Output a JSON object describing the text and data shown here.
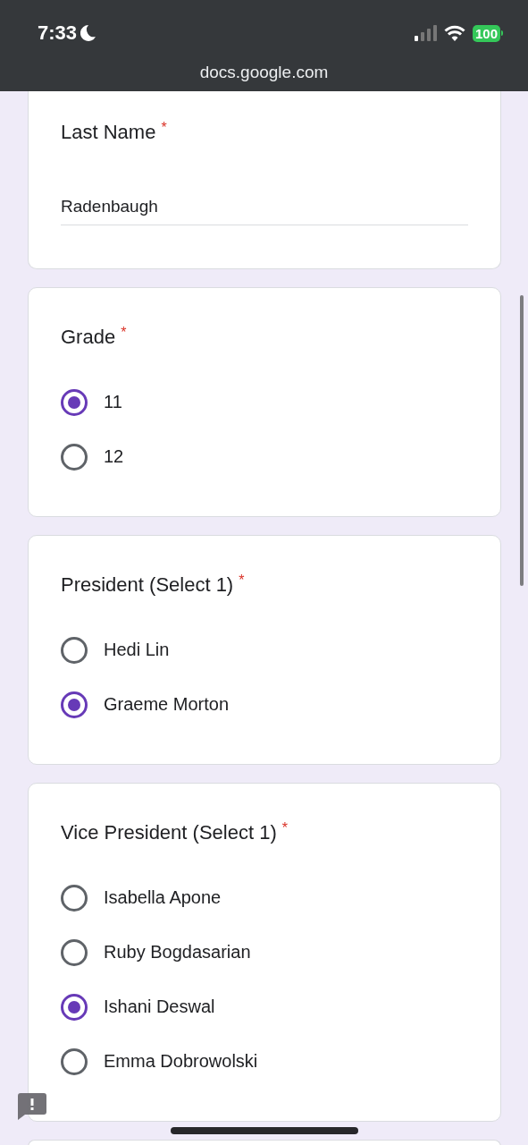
{
  "status_bar": {
    "time": "7:33",
    "battery": "100",
    "url": "docs.google.com"
  },
  "questions": [
    {
      "kind": "text",
      "title": "Last Name",
      "required_mark": "*",
      "value": "Radenbaugh"
    },
    {
      "kind": "choice",
      "title": "Grade",
      "required_mark": "*",
      "options": [
        {
          "label": "11",
          "selected": true
        },
        {
          "label": "12",
          "selected": false
        }
      ]
    },
    {
      "kind": "choice",
      "title": "President (Select 1)",
      "required_mark": "*",
      "options": [
        {
          "label": "Hedi Lin",
          "selected": false
        },
        {
          "label": "Graeme Morton",
          "selected": true
        }
      ]
    },
    {
      "kind": "choice",
      "title": "Vice President (Select 1)",
      "required_mark": "*",
      "options": [
        {
          "label": "Isabella Apone",
          "selected": false
        },
        {
          "label": "Ruby Bogdasarian",
          "selected": false
        },
        {
          "label": "Ishani Deswal",
          "selected": true
        },
        {
          "label": "Emma Dobrowolski",
          "selected": false
        }
      ]
    }
  ]
}
